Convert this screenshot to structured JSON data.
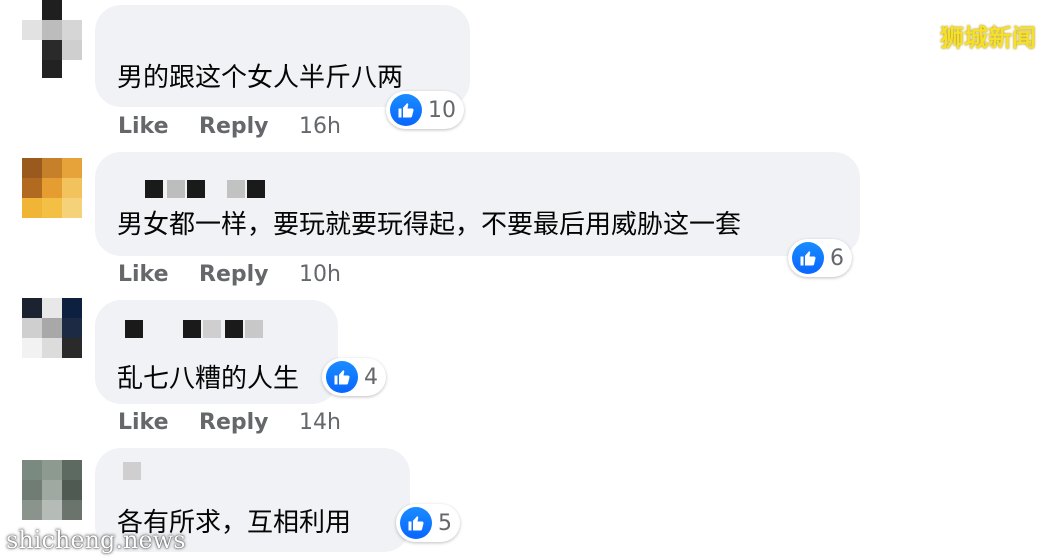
{
  "brand": "狮城新闻",
  "watermark": "shicheng.news",
  "actions": {
    "like": "Like",
    "reply": "Reply"
  },
  "comments": [
    {
      "text": "男的跟这个女人半斤八两",
      "reactions": "10",
      "time": "16h"
    },
    {
      "text": "男女都一样，要玩就要玩得起，不要最后用威胁这一套",
      "reactions": "6",
      "time": "10h"
    },
    {
      "text": "乱七八糟的人生",
      "reactions": "4",
      "time": "14h"
    },
    {
      "text": "各有所求，互相利用",
      "reactions": "5",
      "time": ""
    }
  ],
  "colors": {
    "bubble": "#f0f2f5",
    "like_blue": "#0866ff",
    "meta": "#65676b",
    "brand": "#f5e02a"
  },
  "icons": [
    "like-thumb-icon"
  ]
}
